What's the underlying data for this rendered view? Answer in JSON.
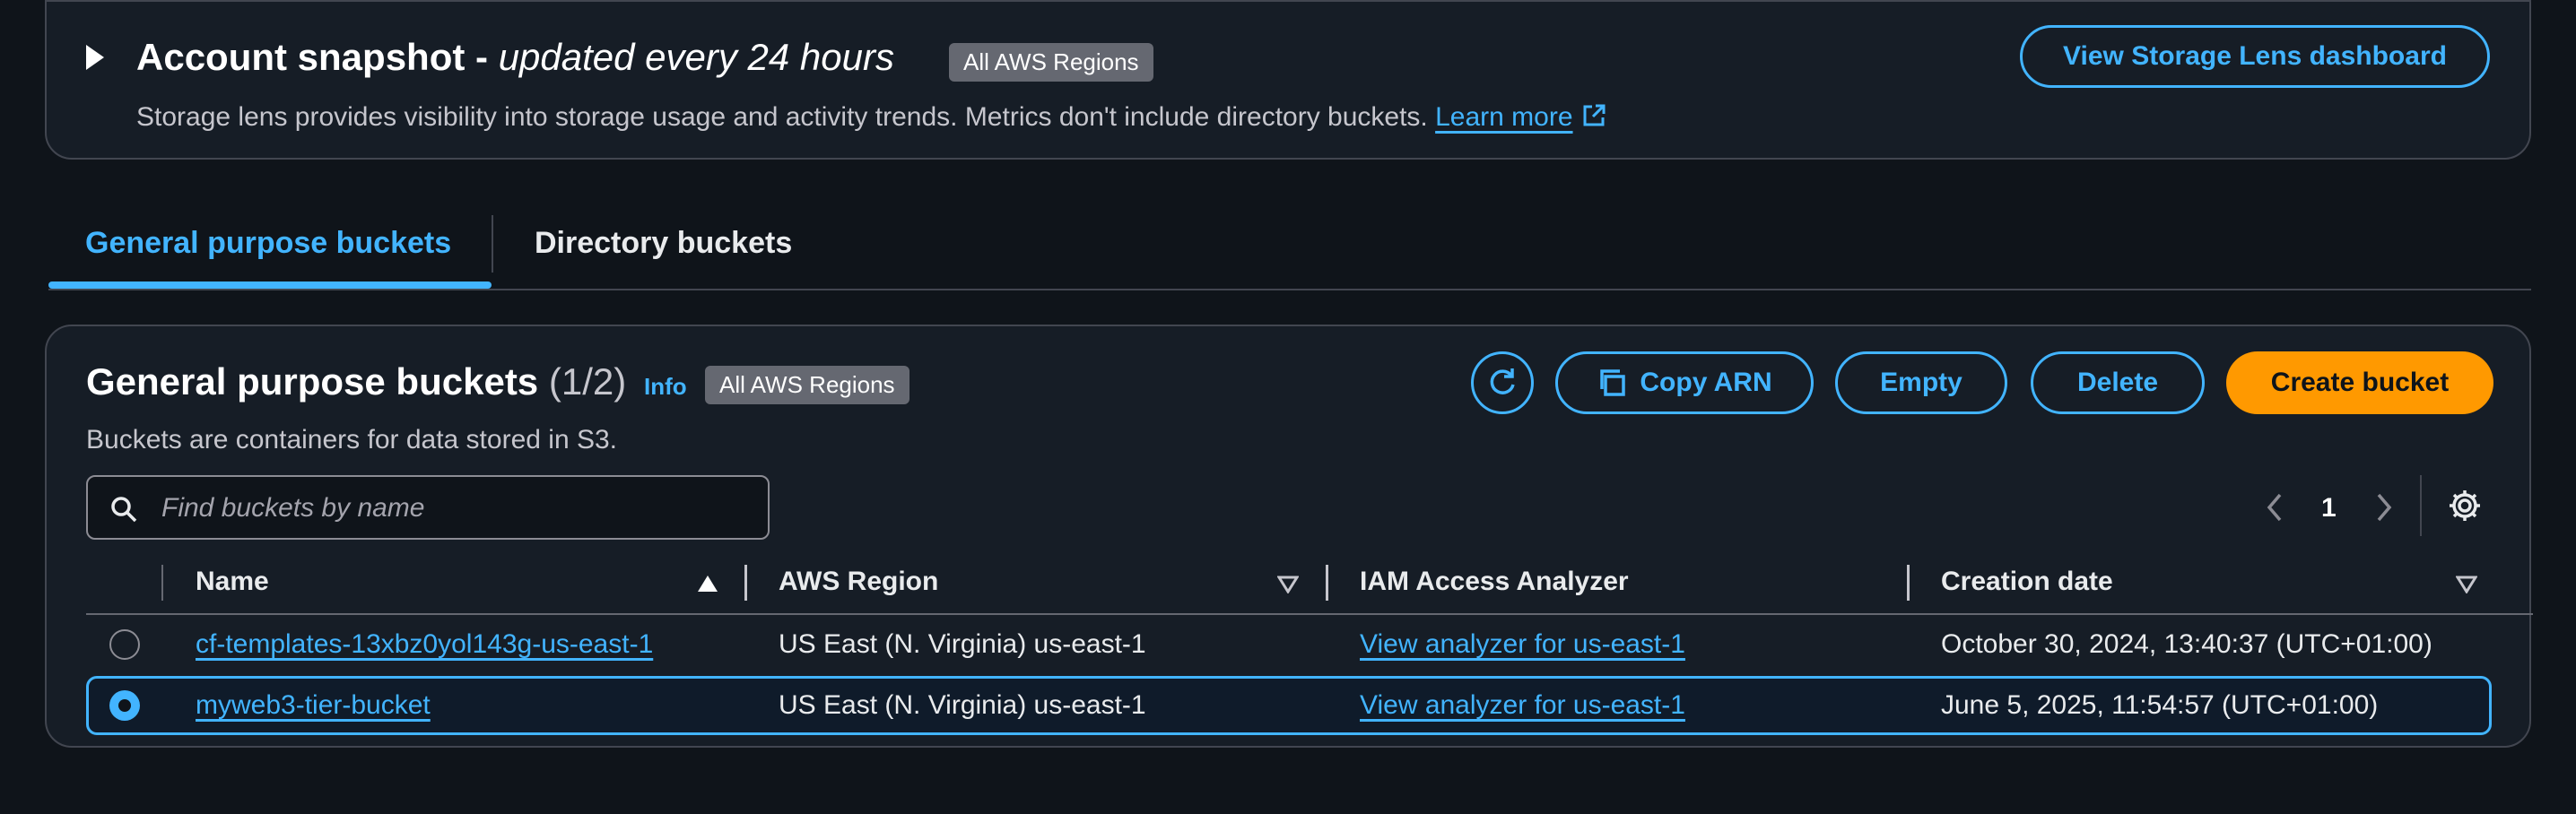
{
  "snapshot": {
    "title": "Account snapshot - ",
    "subtitle": "updated every 24 hours",
    "region_badge": "All AWS Regions",
    "description": "Storage lens provides visibility into storage usage and activity trends. Metrics don't include directory buckets.",
    "learn_more": "Learn more",
    "view_dashboard": "View Storage Lens dashboard"
  },
  "tabs": [
    {
      "label": "General purpose buckets",
      "active": true
    },
    {
      "label": "Directory buckets",
      "active": false
    }
  ],
  "buckets": {
    "title": "General purpose buckets",
    "count": "(1/2)",
    "info": "Info",
    "region_badge": "All AWS Regions",
    "description": "Buckets are containers for data stored in S3.",
    "actions": {
      "copy_arn": "Copy ARN",
      "empty": "Empty",
      "delete": "Delete",
      "create": "Create bucket"
    },
    "search_placeholder": "Find buckets by name",
    "page": "1",
    "columns": [
      "Name",
      "AWS Region",
      "IAM Access Analyzer",
      "Creation date"
    ],
    "rows": [
      {
        "name": "cf-templates-13xbz0yol143g-us-east-1",
        "region": "US East (N. Virginia) us-east-1",
        "analyzer": "View analyzer for us-east-1",
        "created": "October 30, 2024, 13:40:37 (UTC+01:00)",
        "selected": false
      },
      {
        "name": "myweb3-tier-bucket",
        "region": "US East (N. Virginia) us-east-1",
        "analyzer": "View analyzer for us-east-1",
        "created": "June 5, 2025, 11:54:57 (UTC+01:00)",
        "selected": true
      }
    ]
  },
  "colors": {
    "accent": "#42b4ff",
    "primary_button": "#ff9900",
    "background": "#0f141a",
    "panel": "#161d26"
  }
}
